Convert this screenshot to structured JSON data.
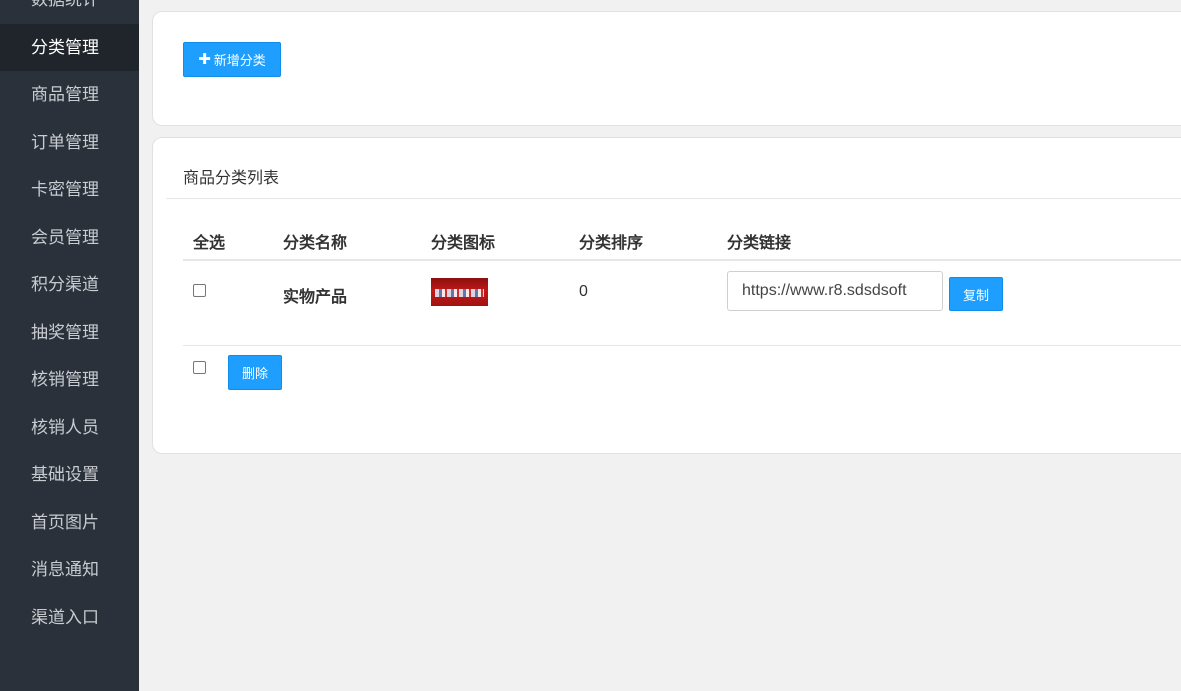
{
  "sidebar": {
    "items": [
      {
        "label": "数据统计",
        "active": false
      },
      {
        "label": "分类管理",
        "active": true
      },
      {
        "label": "商品管理",
        "active": false
      },
      {
        "label": "订单管理",
        "active": false
      },
      {
        "label": "卡密管理",
        "active": false
      },
      {
        "label": "会员管理",
        "active": false
      },
      {
        "label": "积分渠道",
        "active": false
      },
      {
        "label": "抽奖管理",
        "active": false
      },
      {
        "label": "核销管理",
        "active": false
      },
      {
        "label": "核销人员",
        "active": false
      },
      {
        "label": "基础设置",
        "active": false
      },
      {
        "label": "首页图片",
        "active": false
      },
      {
        "label": "消息通知",
        "active": false
      },
      {
        "label": "渠道入口",
        "active": false
      }
    ]
  },
  "toolbar": {
    "add_label": "新增分类",
    "add_icon": "plus-icon"
  },
  "list": {
    "title": "商品分类列表",
    "columns": {
      "select_all": "全选",
      "name": "分类名称",
      "icon": "分类图标",
      "sort": "分类排序",
      "link": "分类链接"
    },
    "rows": [
      {
        "checked": false,
        "name": "实物产品",
        "sort": "0",
        "link": "https://www.r8.sdsdsoft",
        "copy_label": "复制"
      }
    ],
    "delete_label": "删除"
  },
  "colors": {
    "sidebar_bg": "#2a313a",
    "sidebar_active_bg": "#1f252b",
    "primary": "#1e9fff",
    "page_bg": "#f1f1f1"
  }
}
